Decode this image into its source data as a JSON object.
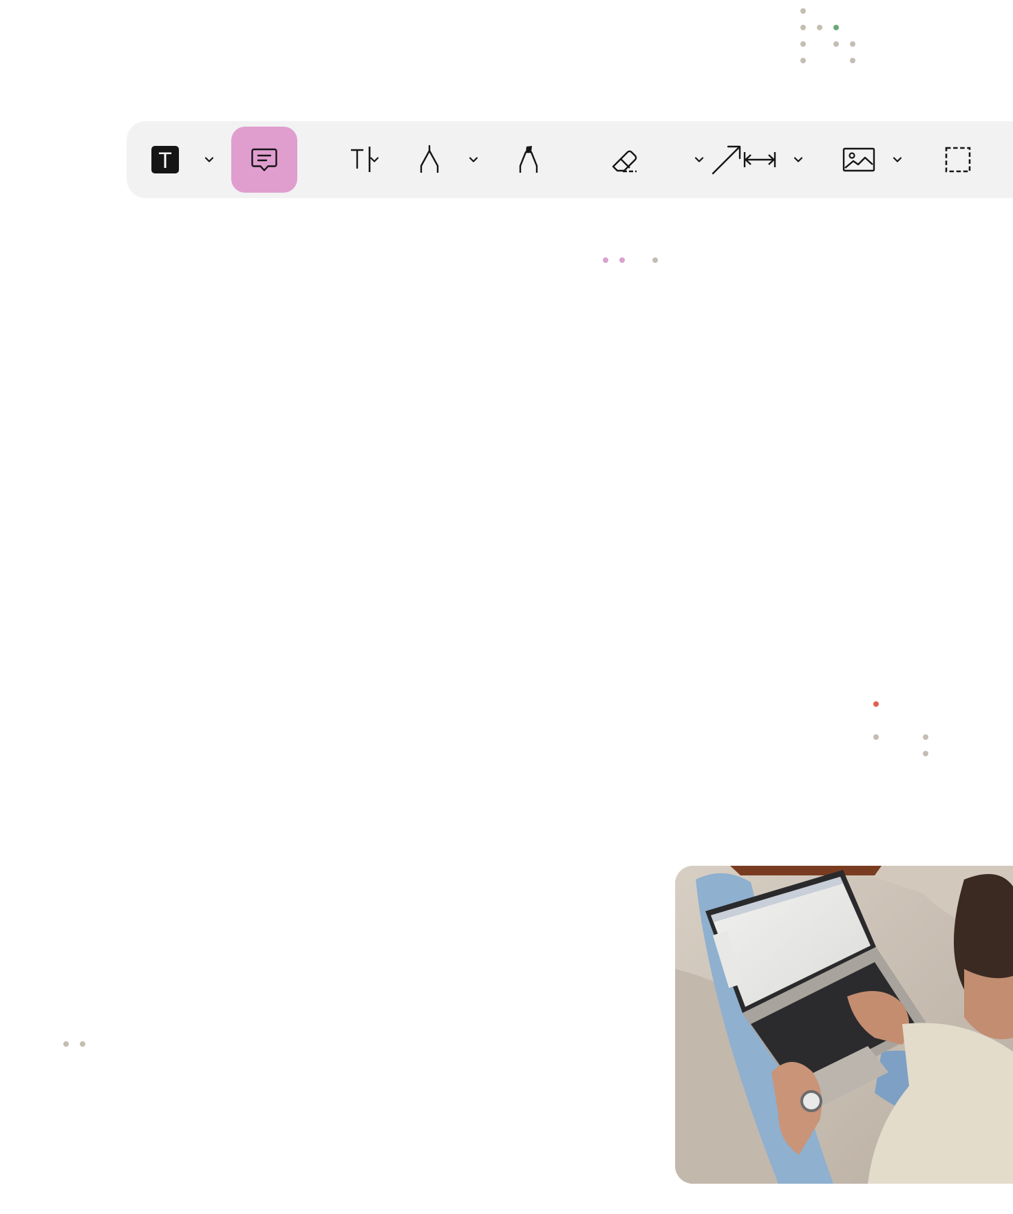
{
  "toolbar": {
    "tools": [
      {
        "id": "text-style",
        "icon": "text-box-icon",
        "active": false,
        "has_dropdown": true
      },
      {
        "id": "comment",
        "icon": "comment-icon",
        "active": true,
        "has_dropdown": false
      },
      {
        "id": "text-cursor",
        "icon": "text-cursor-icon",
        "active": false,
        "has_dropdown": true
      },
      {
        "id": "pen",
        "icon": "pen-nib-icon",
        "active": false,
        "has_dropdown": true
      },
      {
        "id": "highlighter",
        "icon": "highlighter-icon",
        "active": false,
        "has_dropdown": false
      },
      {
        "id": "eraser",
        "icon": "eraser-icon",
        "active": false,
        "has_dropdown": false
      },
      {
        "id": "arrow",
        "icon": "arrow-icon",
        "active": false,
        "has_dropdown": true
      },
      {
        "id": "measure",
        "icon": "measure-icon",
        "active": false,
        "has_dropdown": true
      },
      {
        "id": "image",
        "icon": "image-icon",
        "active": false,
        "has_dropdown": true
      },
      {
        "id": "select",
        "icon": "selection-icon",
        "active": false,
        "has_dropdown": false
      }
    ],
    "text_icon_glyph": "T",
    "active_color": "#e09ecf",
    "background_color": "#f2f2f2"
  },
  "colors": {
    "dot_gray": "#c4bdb2",
    "dot_green": "#6aa876",
    "dot_pink": "#d9a2cf",
    "dot_red": "#e36051"
  },
  "photo": {
    "icon": "person-typing-on-laptop-photo"
  }
}
